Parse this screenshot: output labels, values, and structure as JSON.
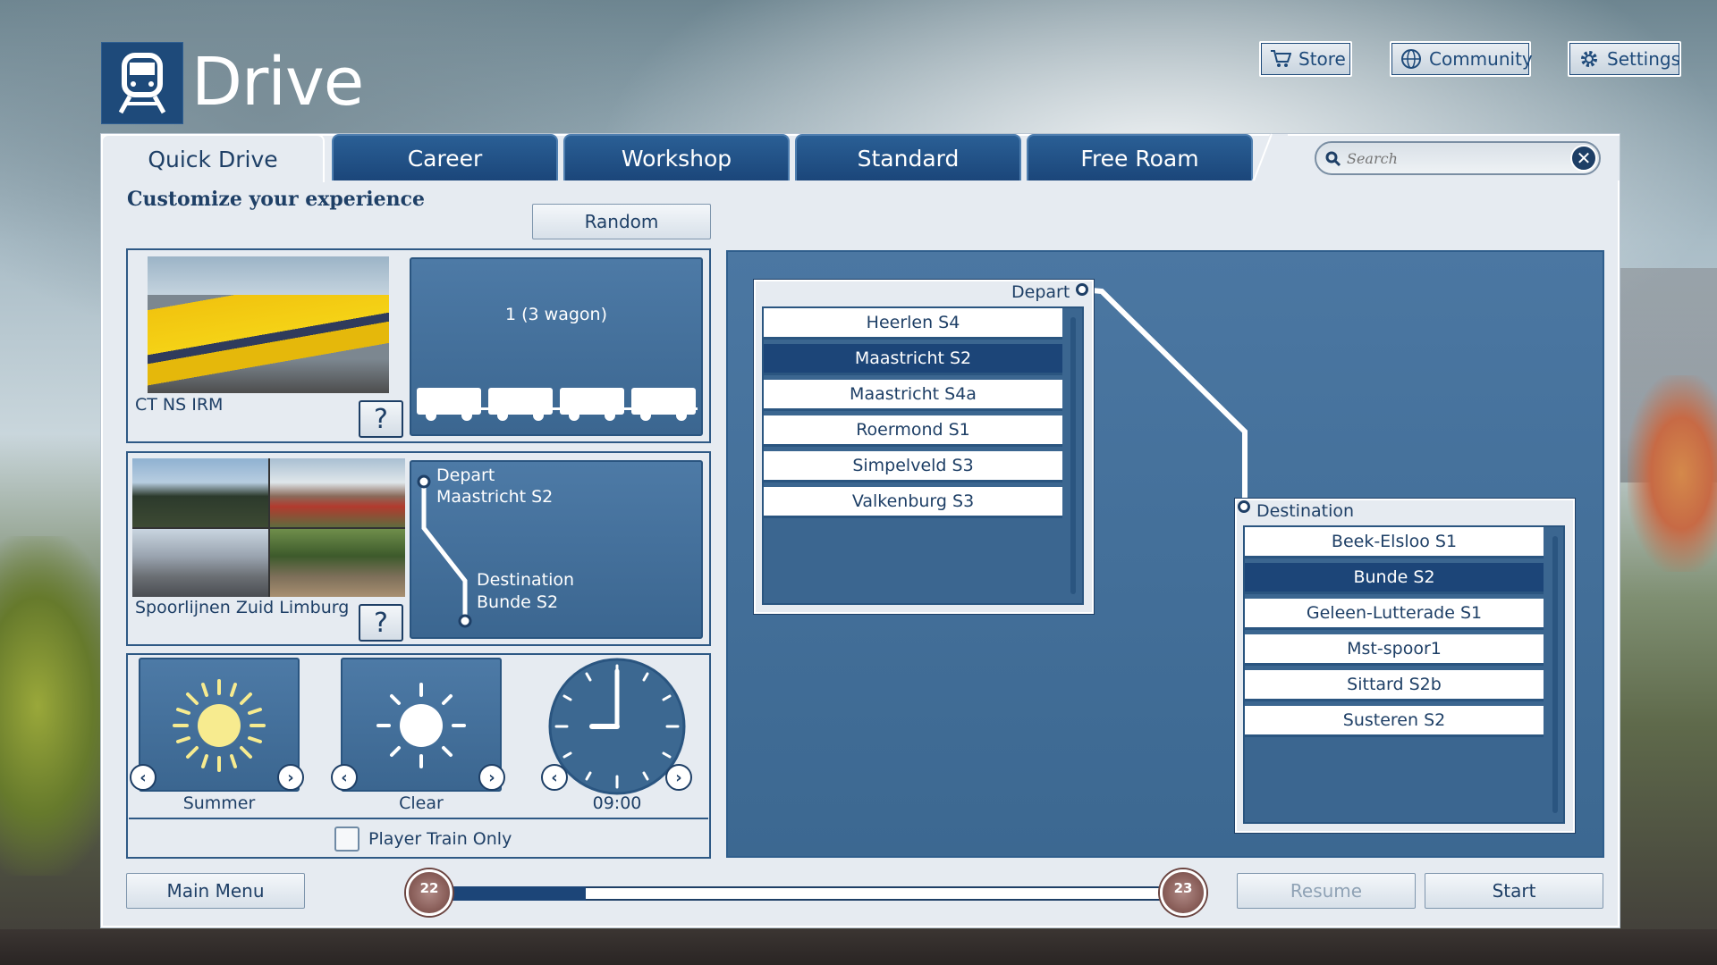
{
  "app": {
    "title": "Drive"
  },
  "top_buttons": {
    "store": "Store",
    "community": "Community",
    "settings": "Settings"
  },
  "tabs": [
    {
      "label": "Quick Drive",
      "active": true
    },
    {
      "label": "Career"
    },
    {
      "label": "Workshop"
    },
    {
      "label": "Standard"
    },
    {
      "label": "Free Roam"
    }
  ],
  "search": {
    "placeholder": "Search",
    "value": ""
  },
  "main": {
    "subtitle": "Customize your experience",
    "random_label": "Random",
    "train": {
      "name": "CT NS IRM",
      "consist": "1 (3 wagon)",
      "help": "?"
    },
    "route": {
      "name": "Spoorlijnen Zuid Limburg",
      "help": "?",
      "depart_label": "Depart",
      "depart_value": "Maastricht S2",
      "destination_label": "Destination",
      "destination_value": "Bunde S2"
    },
    "environment": {
      "season": "Summer",
      "weather": "Clear",
      "time": "09:00",
      "player_train_only": "Player Train Only"
    }
  },
  "map": {
    "depart_title": "Depart",
    "depart_list": [
      "Heerlen S4",
      "Maastricht S2",
      "Maastricht S4a",
      "Roermond S1",
      "Simpelveld S3",
      "Valkenburg S3"
    ],
    "depart_selected": 1,
    "destination_title": "Destination",
    "destination_list": [
      "Beek-Elsloo S1",
      "Bunde S2",
      "Geleen-Lutterade S1",
      "Mst-spoor1",
      "Sittard S2b",
      "Susteren S2"
    ],
    "destination_selected": 1
  },
  "footer": {
    "main_menu": "Main Menu",
    "resume": "Resume",
    "start": "Start",
    "slider_min": "22",
    "slider_max": "23"
  },
  "colors": {
    "accent": "#1c4578",
    "panel": "#e6ebf1",
    "map_blue": "#3c6891"
  }
}
